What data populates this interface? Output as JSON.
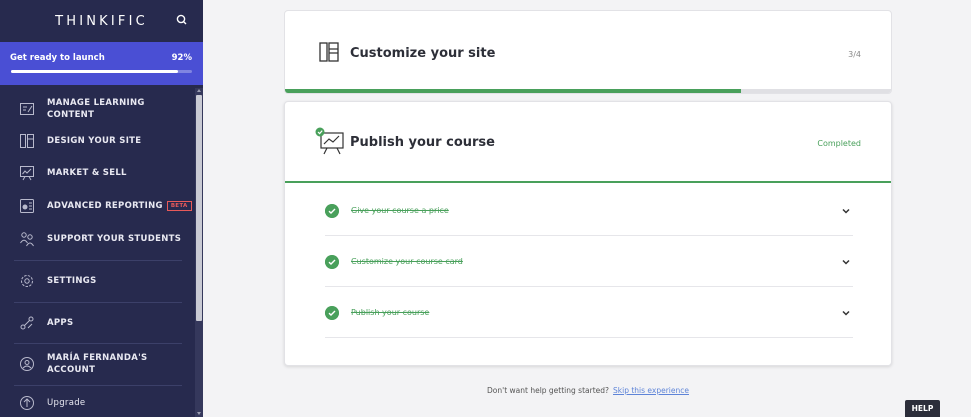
{
  "sidebar": {
    "brand": "THINKIFIC",
    "launch": {
      "label": "Get ready to launch",
      "percent_text": "92%",
      "progress": 0.92
    },
    "items": [
      {
        "label_line1": "MANAGE LEARNING",
        "label_line2": "CONTENT",
        "icon": "manage-content-icon"
      },
      {
        "label_line1": "DESIGN YOUR SITE",
        "icon": "layout-icon"
      },
      {
        "label_line1": "MARKET & SELL",
        "icon": "chart-board-icon"
      },
      {
        "label_line1": "ADVANCED REPORTING",
        "badge": "BETA",
        "icon": "reporting-icon"
      },
      {
        "label_line1": "SUPPORT YOUR STUDENTS",
        "icon": "students-icon"
      },
      {
        "label_line1": "SETTINGS",
        "icon": "gear-icon"
      },
      {
        "label_line1": "APPS",
        "icon": "apps-icon"
      },
      {
        "label_line1": "MARÍA FERNANDA'S",
        "label_line2": "ACCOUNT",
        "icon": "account-icon"
      },
      {
        "label_line1": "Upgrade",
        "icon": "upgrade-arrow-icon"
      }
    ]
  },
  "main": {
    "customize": {
      "title": "Customize your site",
      "count": "3/4",
      "progress": 0.75
    },
    "publish": {
      "title": "Publish your course",
      "status": "Completed",
      "tasks": [
        {
          "label": "Give your course a price"
        },
        {
          "label": "Customize your course card"
        },
        {
          "label": "Publish your course"
        }
      ]
    },
    "footer": {
      "text": "Don't want help getting started?",
      "link": "Skip this experience"
    }
  },
  "help_label": "HELP",
  "colors": {
    "sidebar": "#272a4e",
    "accent": "#4a4fd4",
    "success": "#49a05b",
    "link": "#5e84d8"
  }
}
